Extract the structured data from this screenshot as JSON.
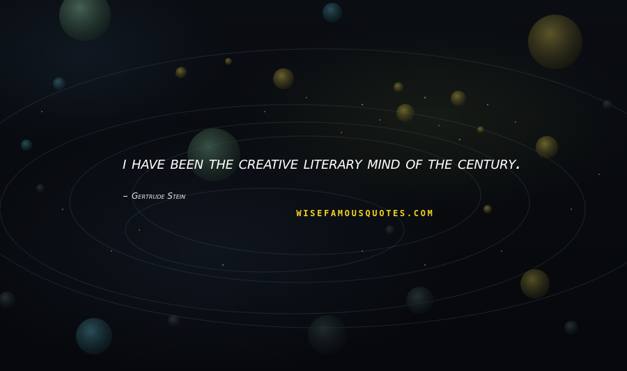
{
  "quote": {
    "text": "I have been the creative literary mind of the century.",
    "author": "Gertrude Stein"
  },
  "branding": {
    "logo_text": "WISEFAMOUSQUOTES.COM",
    "logo_color": "#f2d21b"
  },
  "colors": {
    "background": "#07090c",
    "text": "#ffffff"
  }
}
